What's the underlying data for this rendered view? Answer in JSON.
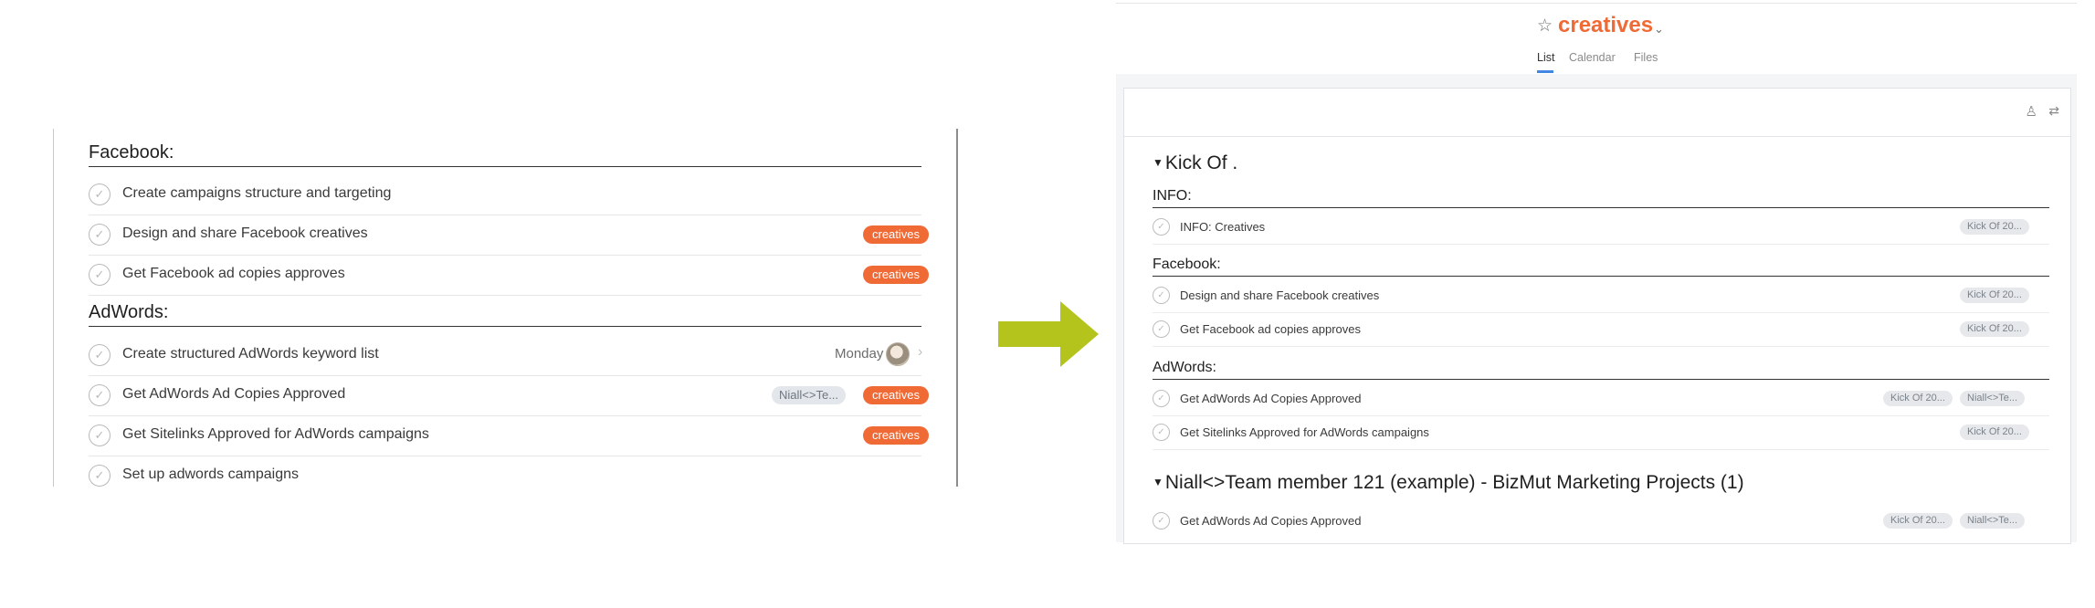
{
  "left": {
    "sections": [
      {
        "title": "Facebook:",
        "rows": [
          {
            "name": "Create campaigns structure and targeting"
          },
          {
            "name": "Design and share Facebook creatives",
            "tag": "creatives"
          },
          {
            "name": "Get Facebook ad copies approves",
            "tag": "creatives"
          }
        ]
      },
      {
        "title": "AdWords:",
        "rows": [
          {
            "name": "Create structured AdWords keyword list",
            "due": "Monday"
          },
          {
            "name": "Get AdWords Ad Copies Approved",
            "assignee_tag": "Niall<>Te...",
            "tag": "creatives"
          },
          {
            "name": "Get Sitelinks Approved for AdWords campaigns",
            "tag": "creatives"
          },
          {
            "name": "Set up adwords campaigns"
          }
        ]
      }
    ],
    "check_glyph": "✓",
    "chevron_glyph": "›"
  },
  "arrow": {
    "color": "#b5c41d"
  },
  "right": {
    "project_title": "creatives",
    "title_color": "#f06a35",
    "star_glyph": "☆",
    "caret_glyph": "⌄",
    "tabs": [
      "List",
      "Calendar",
      "Files"
    ],
    "active_tab": "List",
    "toolbar": {
      "person_glyph": "♙",
      "filter_glyph": "⇄"
    },
    "groups": [
      {
        "title": "Kick Of .",
        "sections": [
          {
            "title": "INFO:",
            "rows": [
              {
                "name": "INFO: Creatives",
                "tags": [
                  "Kick Of 20..."
                ]
              }
            ]
          },
          {
            "title": "Facebook:",
            "rows": [
              {
                "name": "Design and share Facebook creatives",
                "tags": [
                  "Kick Of 20..."
                ]
              },
              {
                "name": "Get Facebook ad copies approves",
                "tags": [
                  "Kick Of 20..."
                ]
              }
            ]
          },
          {
            "title": "AdWords:",
            "rows": [
              {
                "name": "Get AdWords Ad Copies Approved",
                "tags": [
                  "Kick Of 20...",
                  "Niall<>Te..."
                ]
              },
              {
                "name": "Get Sitelinks Approved for AdWords campaigns",
                "tags": [
                  "Kick Of 20..."
                ]
              }
            ]
          }
        ]
      },
      {
        "title": "Niall<>Team member 121 (example) - BizMut Marketing Projects (1)",
        "rows": [
          {
            "name": "Get AdWords Ad Copies Approved",
            "tags": [
              "Kick Of 20...",
              "Niall<>Te..."
            ]
          }
        ]
      }
    ]
  }
}
